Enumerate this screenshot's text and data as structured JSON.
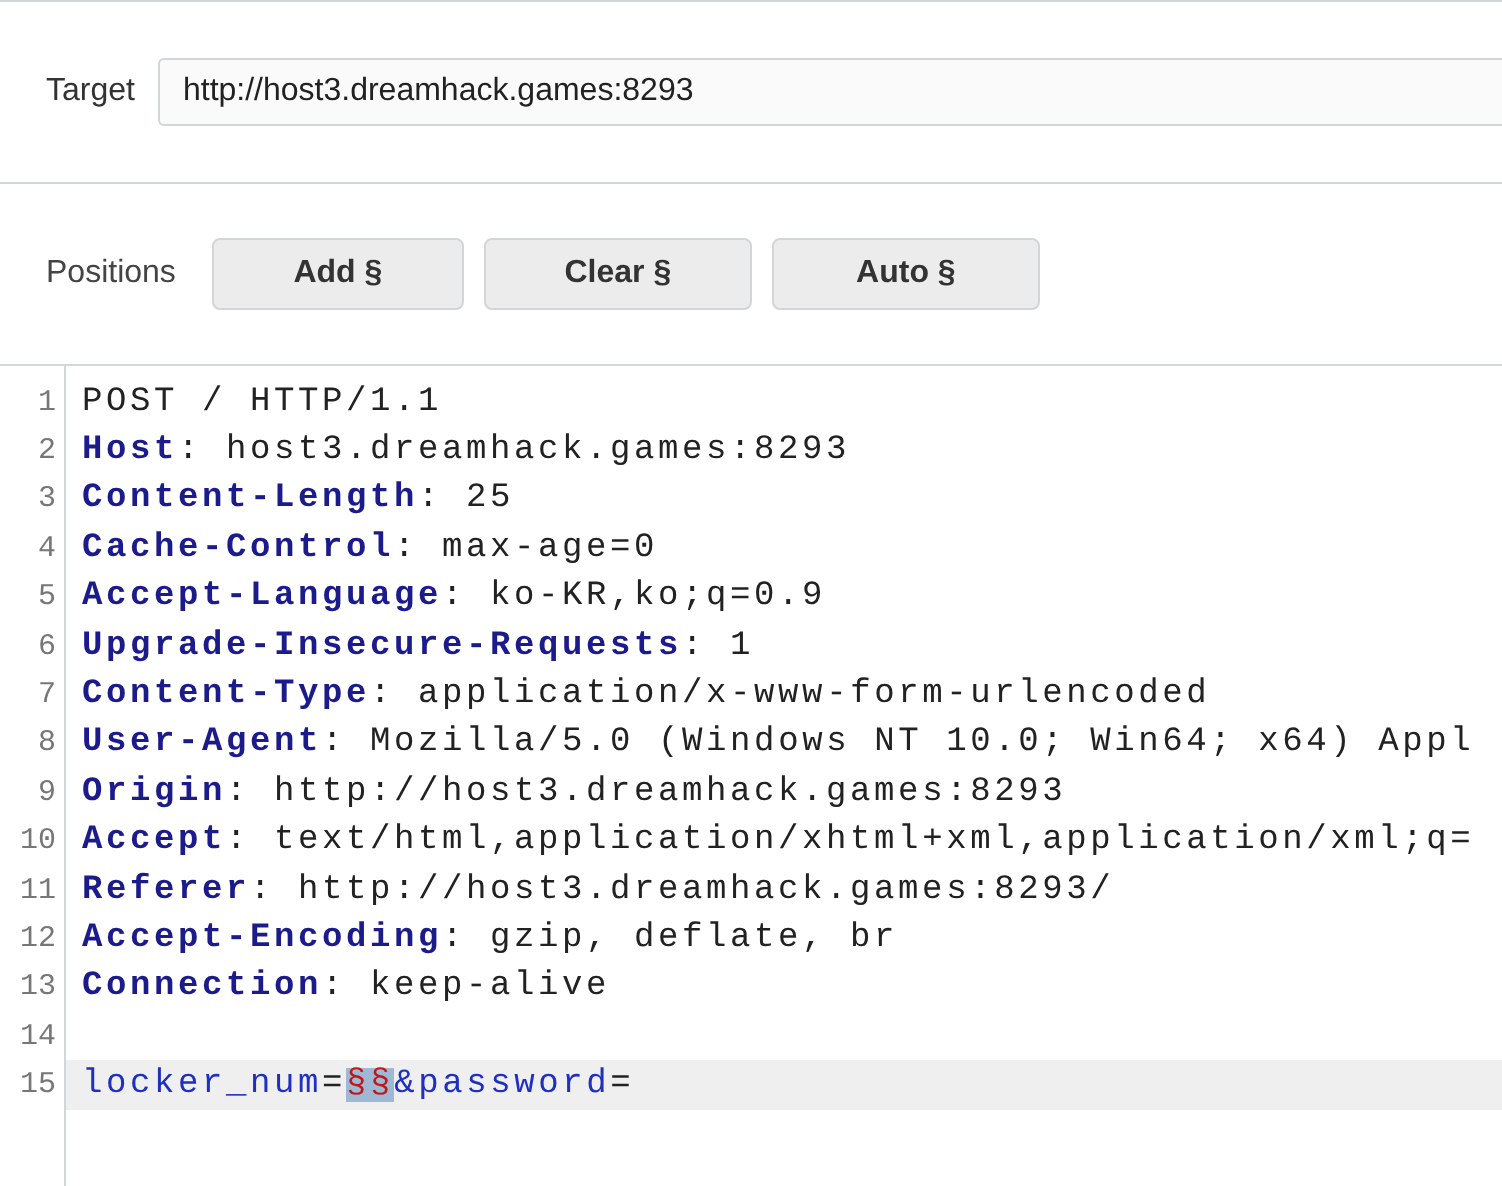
{
  "target": {
    "label": "Target",
    "value": "http://host3.dreamhack.games:8293"
  },
  "positions": {
    "label": "Positions",
    "buttons": [
      "Add §",
      "Clear §",
      "Auto §"
    ]
  },
  "editor": {
    "lines": [
      {
        "number": "1",
        "active": false,
        "segments": [
          {
            "kind": "plain",
            "text": "POST / HTTP/1.1"
          }
        ]
      },
      {
        "number": "2",
        "active": false,
        "segments": [
          {
            "kind": "header_name",
            "text": "Host"
          },
          {
            "kind": "plain",
            "text": ": host3.dreamhack.games:8293"
          }
        ]
      },
      {
        "number": "3",
        "active": false,
        "segments": [
          {
            "kind": "header_name",
            "text": "Content-Length"
          },
          {
            "kind": "plain",
            "text": ": 25"
          }
        ]
      },
      {
        "number": "4",
        "active": false,
        "segments": [
          {
            "kind": "header_name",
            "text": "Cache-Control"
          },
          {
            "kind": "plain",
            "text": ": max-age=0"
          }
        ]
      },
      {
        "number": "5",
        "active": false,
        "segments": [
          {
            "kind": "header_name",
            "text": "Accept-Language"
          },
          {
            "kind": "plain",
            "text": ": ko-KR,ko;q=0.9"
          }
        ]
      },
      {
        "number": "6",
        "active": false,
        "segments": [
          {
            "kind": "header_name",
            "text": "Upgrade-Insecure-Requests"
          },
          {
            "kind": "plain",
            "text": ": 1"
          }
        ]
      },
      {
        "number": "7",
        "active": false,
        "segments": [
          {
            "kind": "header_name",
            "text": "Content-Type"
          },
          {
            "kind": "plain",
            "text": ": application/x-www-form-urlencoded"
          }
        ]
      },
      {
        "number": "8",
        "active": false,
        "segments": [
          {
            "kind": "header_name",
            "text": "User-Agent"
          },
          {
            "kind": "plain",
            "text": ": Mozilla/5.0 (Windows NT 10.0; Win64; x64) Appl"
          }
        ]
      },
      {
        "number": "9",
        "active": false,
        "segments": [
          {
            "kind": "header_name",
            "text": "Origin"
          },
          {
            "kind": "plain",
            "text": ": http://host3.dreamhack.games:8293"
          }
        ]
      },
      {
        "number": "10",
        "active": false,
        "segments": [
          {
            "kind": "header_name",
            "text": "Accept"
          },
          {
            "kind": "plain",
            "text": ": text/html,application/xhtml+xml,application/xml;q="
          }
        ]
      },
      {
        "number": "11",
        "active": false,
        "segments": [
          {
            "kind": "header_name",
            "text": "Referer"
          },
          {
            "kind": "plain",
            "text": ": http://host3.dreamhack.games:8293/"
          }
        ]
      },
      {
        "number": "12",
        "active": false,
        "segments": [
          {
            "kind": "header_name",
            "text": "Accept-Encoding"
          },
          {
            "kind": "plain",
            "text": ": gzip, deflate, br"
          }
        ]
      },
      {
        "number": "13",
        "active": false,
        "segments": [
          {
            "kind": "header_name",
            "text": "Connection"
          },
          {
            "kind": "plain",
            "text": ": keep-alive"
          }
        ]
      },
      {
        "number": "14",
        "active": false
      },
      {
        "number": "15",
        "active": true,
        "segments": [
          {
            "kind": "param",
            "text": "locker_num"
          },
          {
            "kind": "plain",
            "text": "="
          },
          {
            "kind": "payload_marker",
            "text": "§§"
          },
          {
            "kind": "param",
            "text": "&password"
          },
          {
            "kind": "plain",
            "text": "="
          }
        ]
      }
    ]
  }
}
